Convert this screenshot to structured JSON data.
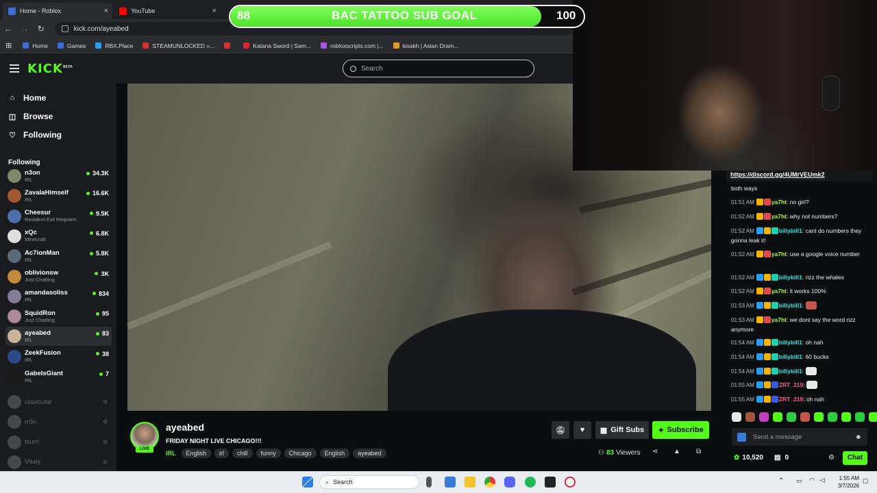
{
  "browser": {
    "tabs": [
      {
        "label": "Home - Roblox",
        "color": "#3d6bd9"
      },
      {
        "label": "YouTube",
        "color": "#ff0000"
      }
    ],
    "url": "kick.com/ayeabed",
    "bookmarks": [
      {
        "label": "Home",
        "color": "#3d6bd9"
      },
      {
        "label": "Games",
        "color": "#3d6bd9"
      },
      {
        "label": "RBX.Place",
        "color": "#2a9df4"
      },
      {
        "label": "STEAMUNLOCKED »...",
        "color": "#d62d2d"
      },
      {
        "label": "",
        "color": "#d62d2d"
      },
      {
        "label": "Katana Sword | Sam...",
        "color": "#e0243b"
      },
      {
        "label": "robloxscripts.com |...",
        "color": "#a555e0"
      },
      {
        "label": "kisskh | Asian Dram...",
        "color": "#e09a24"
      }
    ]
  },
  "kick": {
    "logo": "KICK",
    "logo_beta": "BETA",
    "search_placeholder": "Search",
    "accent": "#53fc18"
  },
  "sidebar": {
    "nav": [
      {
        "label": "Home",
        "icon": "home-icon",
        "glyph": "⌂"
      },
      {
        "label": "Browse",
        "icon": "browse-icon",
        "glyph": "◫"
      },
      {
        "label": "Following",
        "icon": "heart-icon",
        "glyph": "♡"
      }
    ],
    "following_header": "Following",
    "channels": [
      {
        "name": "n3on",
        "category": "IRL",
        "viewers": "34.3K",
        "color": "#7a8a6a"
      },
      {
        "name": "ZavalaHimself",
        "category": "IRL",
        "viewers": "16.6K",
        "color": "#a4572e"
      },
      {
        "name": "Cheesur",
        "category": "Resident Evil Requiem",
        "viewers": "9.5K",
        "color": "#4a6ea8"
      },
      {
        "name": "xQc",
        "category": "Minecraft",
        "viewers": "6.8K",
        "color": "#dddddd"
      },
      {
        "name": "Ac7ionMan",
        "category": "IRL",
        "viewers": "5.8K",
        "color": "#5a6a7a"
      },
      {
        "name": "oblivionsw",
        "category": "Just Chatting",
        "viewers": "3K",
        "color": "#c28a3a"
      },
      {
        "name": "amandasoliss",
        "category": "IRL",
        "viewers": "834",
        "color": "#8a7a9a"
      },
      {
        "name": "SquidRon",
        "category": "Just Chatting",
        "viewers": "95",
        "color": "#aa8a9a"
      },
      {
        "name": "ayeabed",
        "category": "IRL",
        "viewers": "83",
        "color": "#c9b49a",
        "active": true
      },
      {
        "name": "ZeekFusion",
        "category": "IRL",
        "viewers": "38",
        "color": "#2a4a8a"
      },
      {
        "name": "GabeIsGiant",
        "category": "IRL",
        "viewers": "7",
        "color": "#1a1a1a"
      }
    ],
    "offline": [
      {
        "name": "clavicular",
        "color": "#8a8a8a"
      },
      {
        "name": "rr0n",
        "color": "#8a8a8a"
      },
      {
        "name": "blurri",
        "color": "#8a8a8a"
      },
      {
        "name": "Vitaly",
        "color": "#8a8a8a"
      }
    ]
  },
  "goal": {
    "start": "88",
    "title": "BAC TATTOO SUB GOAL",
    "end": "100",
    "progress": 0.88
  },
  "stream": {
    "username": "ayeabed",
    "live_badge": "LIVE",
    "title": "FRIDAY NIGHT LIVE CHICAGO!!!",
    "category": "IRL",
    "tags": [
      "English",
      "irl",
      "chill",
      "funny",
      "Chicago",
      "English",
      "ayeabed"
    ],
    "gift_label": "Gift Subs",
    "subscribe_label": "Subscribe",
    "viewer_count": "83",
    "viewers_label": "Viewers"
  },
  "chat": {
    "pinned_link": "https://discord.gg/4UMrVEUmk2",
    "messages": [
      {
        "time": "",
        "user": "",
        "color": "#ffffff",
        "text": "both ways",
        "badges": []
      },
      {
        "time": "01:51 AM",
        "user": "ya7ht",
        "color": "#b3ff2b",
        "text": "no girl?",
        "badges": [
          "#f5b400",
          "#e24a4a"
        ]
      },
      {
        "time": "01:52 AM",
        "user": "ya7ht",
        "color": "#b3ff2b",
        "text": "why not numbers?",
        "badges": [
          "#f5b400",
          "#e24a4a"
        ]
      },
      {
        "time": "01:52 AM",
        "user": "billybill1",
        "color": "#2ee6e6",
        "text": "cant do numbers they gonna leak it!",
        "badges": [
          "#2a9df4",
          "#f5b400",
          "#1fd1a8"
        ]
      },
      {
        "time": "01:52 AM",
        "user": "ya7ht",
        "color": "#b3ff2b",
        "text": "use a google voice number",
        "badges": [
          "#f5b400",
          "#e24a4a"
        ]
      },
      {
        "time": "01:52 AM",
        "user": "billybill1",
        "color": "#2ee6e6",
        "text": "rizz the whales",
        "badges": [
          "#2a9df4",
          "#f5b400",
          "#1fd1a8"
        ]
      },
      {
        "time": "01:52 AM",
        "user": "ya7ht",
        "color": "#b3ff2b",
        "text": "it works 100%",
        "badges": [
          "#f5b400",
          "#e24a4a"
        ]
      },
      {
        "time": "01:53 AM",
        "user": "billybill1",
        "color": "#2ee6e6",
        "text": "",
        "emote": "#c0584a",
        "badges": [
          "#2a9df4",
          "#f5b400",
          "#1fd1a8"
        ]
      },
      {
        "time": "01:53 AM",
        "user": "ya7ht",
        "color": "#b3ff2b",
        "text": "we dont say the word rizz anymore",
        "badges": [
          "#f5b400",
          "#e24a4a"
        ]
      },
      {
        "time": "01:54 AM",
        "user": "billybill1",
        "color": "#2ee6e6",
        "text": "oh nah",
        "badges": [
          "#2a9df4",
          "#f5b400",
          "#1fd1a8"
        ]
      },
      {
        "time": "01:54 AM",
        "user": "billybill1",
        "color": "#2ee6e6",
        "text": "60 bucks",
        "badges": [
          "#2a9df4",
          "#f5b400",
          "#1fd1a8"
        ]
      },
      {
        "time": "01:54 AM",
        "user": "billybill1",
        "color": "#2ee6e6",
        "text": "",
        "emote": "#e8e8e8",
        "badges": [
          "#2a9df4",
          "#f5b400",
          "#1fd1a8"
        ]
      },
      {
        "time": "01:55 AM",
        "user": "ZRT_219",
        "color": "#ff5a8a",
        "text": "",
        "emote": "#e8e8e8",
        "badges": [
          "#2a9df4",
          "#f5b400",
          "#3a5ae0"
        ]
      },
      {
        "time": "01:55 AM",
        "user": "ZRT_219",
        "color": "#ff5a8a",
        "text": "oh nah",
        "badges": [
          "#2a9df4",
          "#f5b400",
          "#3a5ae0"
        ]
      }
    ],
    "emotes": [
      "#e8e8e8",
      "#a0553a",
      "#c040c0",
      "#53fc18",
      "#2ecc40",
      "#c0584a",
      "#53fc18",
      "#2ecc40",
      "#53fc18",
      "#2ecc40",
      "#53fc18"
    ],
    "input_placeholder": "Send a message",
    "points": "10,520",
    "gifts": "0",
    "chat_button": "Chat"
  },
  "taskbar": {
    "search_label": "Search",
    "time": "1:55 AM",
    "date": "3/7/2026"
  }
}
